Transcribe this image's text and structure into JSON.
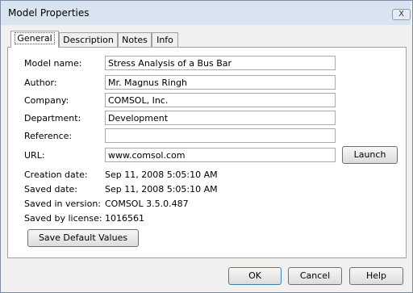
{
  "window": {
    "title": "Model Properties",
    "close_label": "X"
  },
  "tabs": [
    {
      "label": "General"
    },
    {
      "label": "Description"
    },
    {
      "label": "Notes"
    },
    {
      "label": "Info"
    }
  ],
  "fields": {
    "model_name": {
      "label": "Model name:",
      "value": "Stress Analysis of a Bus Bar"
    },
    "author": {
      "label": "Author:",
      "value": "Mr. Magnus Ringh"
    },
    "company": {
      "label": "Company:",
      "value": "COMSOL, Inc."
    },
    "department": {
      "label": "Department:",
      "value": "Development"
    },
    "reference": {
      "label": "Reference:",
      "value": ""
    },
    "url": {
      "label": "URL:",
      "value": "www.comsol.com"
    }
  },
  "info": {
    "creation_date": {
      "label": "Creation date:",
      "value": "Sep 11, 2008 5:05:10 AM"
    },
    "saved_date": {
      "label": "Saved date:",
      "value": "Sep 11, 2008 5:05:10 AM"
    },
    "saved_version": {
      "label": "Saved in version:",
      "value": "COMSOL 3.5.0.487"
    },
    "saved_license": {
      "label": "Saved by license:",
      "value": "1016561"
    }
  },
  "buttons": {
    "launch": "Launch",
    "save_defaults": "Save Default Values",
    "ok": "OK",
    "cancel": "Cancel",
    "help": "Help"
  }
}
